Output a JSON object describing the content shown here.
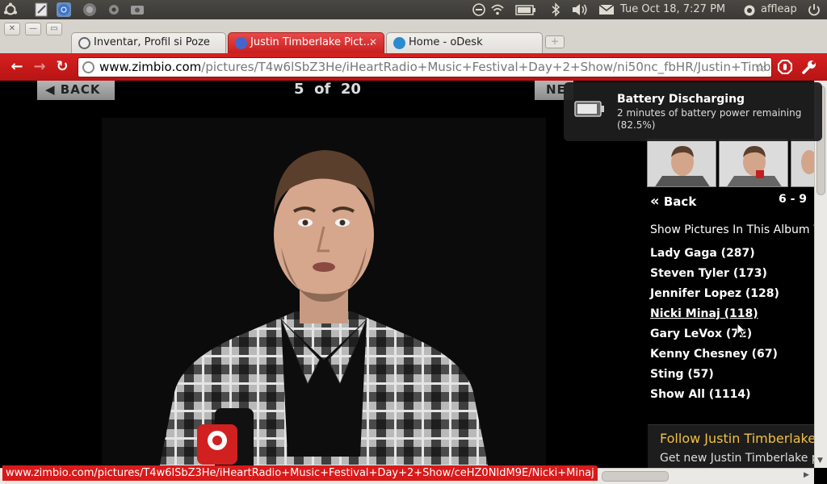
{
  "panel": {
    "datetime": "Tue Oct 18,  7:27 PM",
    "user": "affleap"
  },
  "tabs": [
    {
      "label": "Inventar, Profil si Poze",
      "active": false
    },
    {
      "label": "Justin Timberlake Pict…",
      "active": true
    },
    {
      "label": "Home - oDesk",
      "active": false
    }
  ],
  "omnibox": {
    "host": "www.zimbio.com",
    "path": "/pictures/T4w6lSbZ3He/iHeartRadio+Music+Festival+Day+2+Show/ni50nc_fbHR/Justin+Timberl"
  },
  "gallery": {
    "back_label": "BACK",
    "next_label": "NE",
    "current": "5",
    "of": "of",
    "total": "20"
  },
  "sidebar": {
    "back_label": "Back",
    "range": "6 - 9",
    "heading": "Show Pictures In This Album W",
    "links": [
      "Lady Gaga (287)",
      "Steven Tyler (173)",
      "Jennifer Lopez (128)",
      "Nicki Minaj (118)",
      "Gary LeVox (72)",
      "Kenny Chesney (67)",
      "Sting (57)",
      "Show All (1114)"
    ],
    "follow_title": "Follow Justin Timberlake",
    "follow_text": "Get new Justin Timberlake pic"
  },
  "notification": {
    "title": "Battery Discharging",
    "line1": "2 minutes of battery power remaining",
    "line2": "(82.5%)"
  },
  "status_url": "www.zimbio.com/pictures/T4w6lSbZ3He/iHeartRadio+Music+Festival+Day+2+Show/ceHZ0NIdM9E/Nicki+Minaj",
  "colors": {
    "chrome_red": "#c81e1e",
    "panel_bg": "#3c3b37",
    "page_bg": "#000000",
    "follow_title": "#f0c040"
  }
}
